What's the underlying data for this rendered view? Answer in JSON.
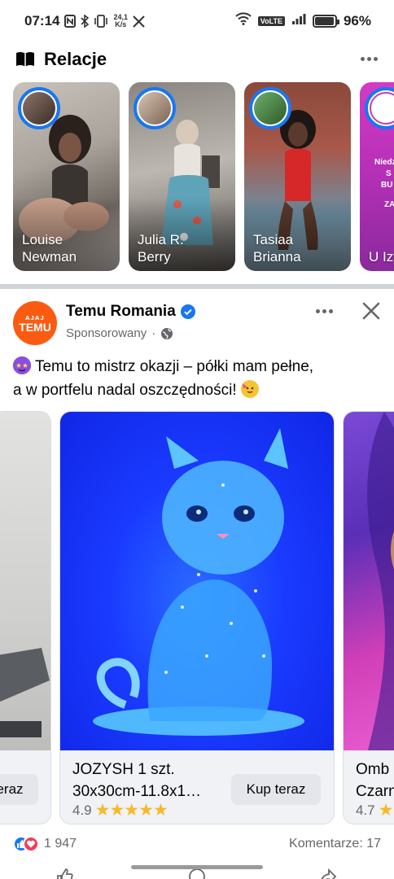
{
  "status_bar": {
    "time": "07:14",
    "net_speed_value": "24,1",
    "net_speed_unit": "K/s",
    "volte": "VoLTE",
    "battery": "96%",
    "battery_level": 0.96
  },
  "stories": {
    "title": "Relacje",
    "items": [
      {
        "name_line1": "Louise",
        "name_line2": "Newman"
      },
      {
        "name_line1": "Julia R.",
        "name_line2": "Berry"
      },
      {
        "name_line1": "Tasiaa",
        "name_line2": "Brianna"
      },
      {
        "name_line1": "U Izy",
        "name_line2": "",
        "overlay_text_1": "Niedz",
        "overlay_text_2": "S",
        "overlay_text_3": "BU",
        "overlay_text_4": "ZA"
      }
    ]
  },
  "post": {
    "author": "Temu Romania",
    "sponsored": "Sponsorowany",
    "separator": "·",
    "avatar_text_top": "ᴀᴊᴀᴊ",
    "avatar_text_bottom": "TEMU",
    "text_line1": "Temu to mistrz okazji – półki mam pełne,",
    "text_line2": "a w portfelu nadal oszczędności!",
    "cards": [
      {
        "cta": "eraz"
      },
      {
        "title_line1": "JOZYSH 1 szt.",
        "title_line2": "30x30cm-11.8x1…",
        "rating": "4.9",
        "stars": "★★★★★",
        "cta": "Kup teraz"
      },
      {
        "title_line1": "Omb",
        "title_line2": "Czarn",
        "rating": "4.7",
        "stars": "★"
      }
    ],
    "reactions_count": "1 947",
    "comments": "Komentarze: 17"
  },
  "colors": {
    "facebook_blue": "#1877f2",
    "temu_orange": "#fb5b11",
    "star_yellow": "#f7b928"
  }
}
